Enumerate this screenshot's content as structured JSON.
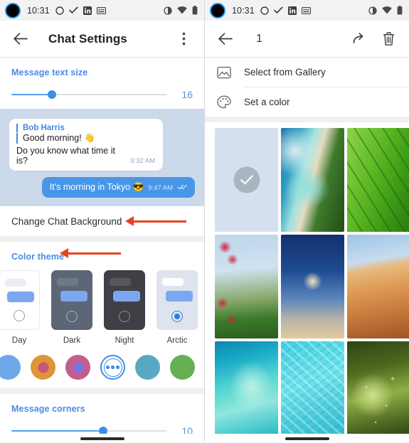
{
  "status_bar": {
    "time": "10:31",
    "left_icons": [
      "avatar-dot",
      "circle-outline-icon",
      "checkmark-icon",
      "linkedin-icon",
      "keyboard-icon"
    ],
    "right_icons": [
      "brightness-icon",
      "wifi-icon",
      "battery-icon"
    ]
  },
  "left_screen": {
    "appbar": {
      "back_icon": "back-arrow-icon",
      "title": "Chat Settings",
      "overflow_icon": "more-vertical-icon"
    },
    "message_text_size": {
      "label": "Message text size",
      "value": "16",
      "fill_percent": 26
    },
    "chat_preview": {
      "incoming": {
        "sender": "Bob Harris",
        "line1": "Good morning! 👋",
        "line2": "Do you know what time it is?",
        "time": "9:32 AM"
      },
      "outgoing": {
        "text": "It's morning in Tokyo 😎",
        "time": "9:47 AM",
        "status_icon": "double-check-icon"
      }
    },
    "change_background": {
      "label": "Change Chat Background",
      "annotation_icon": "red-arrow-left-icon"
    },
    "color_theme": {
      "label": "Color theme",
      "annotation_icon": "red-arrow-left-icon",
      "themes": [
        {
          "name": "Day",
          "selected": false,
          "card_bg": "#ffffff",
          "bar_bg": "#e9eef5",
          "border": "#e4e7ec"
        },
        {
          "name": "Dark",
          "selected": false,
          "card_bg": "#5c6676",
          "bar_bg": "#6e7888",
          "border": "transparent"
        },
        {
          "name": "Night",
          "selected": false,
          "card_bg": "#3e4045",
          "bar_bg": "#55575c",
          "border": "transparent"
        },
        {
          "name": "Arctic",
          "selected": true,
          "card_bg": "#dde4ee",
          "bar_bg": "#ffffff",
          "border": "transparent"
        }
      ],
      "swatches": [
        {
          "name": "swatch-blue",
          "outer": "#6fa8e8",
          "inner": ""
        },
        {
          "name": "swatch-orange",
          "outer": "#e09338",
          "inner": "#c4577a"
        },
        {
          "name": "swatch-magenta",
          "outer": "#c45d8f",
          "inner": "#7b76dd"
        },
        {
          "name": "swatch-more",
          "outer": "",
          "inner": ""
        },
        {
          "name": "swatch-teal",
          "outer": "#58a8c4",
          "inner": ""
        },
        {
          "name": "swatch-green",
          "outer": "#64b053",
          "inner": ""
        },
        {
          "name": "swatch-pink",
          "outer": "#d14a8e",
          "inner": ""
        }
      ]
    },
    "message_corners": {
      "label": "Message corners",
      "value": "10",
      "fill_percent": 59
    }
  },
  "right_screen": {
    "appbar": {
      "back_icon": "back-arrow-icon",
      "title": "1",
      "share_icon": "share-arrow-icon",
      "delete_icon": "trash-icon"
    },
    "options": [
      {
        "label": "Select from Gallery",
        "icon": "image-icon"
      },
      {
        "label": "Set a color",
        "icon": "palette-icon"
      }
    ],
    "gallery": {
      "selected_check_icon": "check-icon",
      "rows": [
        [
          {
            "name": "tile-selected-plain",
            "selected": true,
            "c1": "#d5e0ef",
            "c2": "#d5e0ef",
            "c3": "#d5e0ef"
          },
          {
            "name": "tile-coastline",
            "selected": false,
            "c1": "#1a6fa8",
            "c2": "#7fd4d6",
            "c3": "#2f5c22"
          },
          {
            "name": "tile-green-leaf",
            "selected": false,
            "c1": "#72c63a",
            "c2": "#3f9c18",
            "c3": "#2b7a12"
          }
        ],
        [
          {
            "name": "tile-eiffel-tower",
            "selected": false,
            "c1": "#bdd6ea",
            "c2": "#cf2a4e",
            "c3": "#3a7a2a"
          },
          {
            "name": "tile-lighthouse",
            "selected": false,
            "c1": "#1b3f86",
            "c2": "#4f7bb8",
            "c3": "#d8c89a"
          },
          {
            "name": "tile-sand-dune",
            "selected": false,
            "c1": "#9dc4e6",
            "c2": "#dd9a54",
            "c3": "#b5682c"
          }
        ],
        [
          {
            "name": "tile-overwater-villas",
            "selected": false,
            "c1": "#1aa3c4",
            "c2": "#5fd8d2",
            "c3": "#9fe6dd"
          },
          {
            "name": "tile-turquoise-water",
            "selected": false,
            "c1": "#3ecfe0",
            "c2": "#6fe3ea",
            "c3": "#33bcd4"
          },
          {
            "name": "tile-sunlit-foliage",
            "selected": false,
            "c1": "#3b4d1c",
            "c2": "#85a843",
            "c3": "#2d3b16"
          }
        ]
      ]
    }
  }
}
